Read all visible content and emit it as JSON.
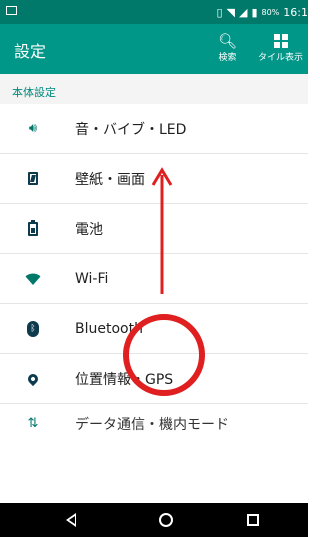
{
  "status_bar": {
    "battery_percent": "80%",
    "time": "16:1"
  },
  "app_bar": {
    "title": "設定",
    "actions": [
      {
        "label": "検索",
        "icon": "search-icon"
      },
      {
        "label": "タイル表示",
        "icon": "grid-icon"
      }
    ]
  },
  "section": {
    "title": "本体設定"
  },
  "items": [
    {
      "label": "音・バイブ・LED",
      "icon": "volume-icon"
    },
    {
      "label": "壁紙・画面",
      "icon": "wallpaper-icon"
    },
    {
      "label": "電池",
      "icon": "battery-icon"
    },
    {
      "label": "Wi-Fi",
      "icon": "wifi-icon"
    },
    {
      "label": "Bluetooth",
      "icon": "bluetooth-icon"
    },
    {
      "label": "位置情報・GPS",
      "icon": "location-icon"
    },
    {
      "label": "データ通信・機内モード",
      "icon": "data-icon"
    }
  ],
  "colors": {
    "accent": "#009688",
    "status": "#00796b",
    "annotation": "#e02020"
  }
}
